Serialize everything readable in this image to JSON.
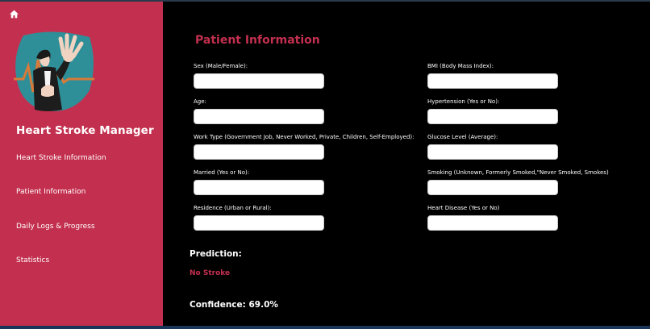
{
  "app": {
    "title": "Heart Stroke Manager"
  },
  "sidebar": {
    "items": [
      {
        "label": "Heart Stroke Information"
      },
      {
        "label": "Patient Information"
      },
      {
        "label": "Daily Logs & Progress"
      },
      {
        "label": "Statistics"
      }
    ]
  },
  "main": {
    "title": "Patient Information",
    "left_fields": [
      {
        "label": "Sex (Male/Female):",
        "value": ""
      },
      {
        "label": "Age:",
        "value": ""
      },
      {
        "label": "Work Type (Government Job, Never Worked, Private, Children, Self-Employed):",
        "value": ""
      },
      {
        "label": "Married (Yes or No):",
        "value": ""
      },
      {
        "label": "Residence (Urban or Rural):",
        "value": ""
      }
    ],
    "right_fields": [
      {
        "label": "BMI (Body Mass Index):",
        "value": ""
      },
      {
        "label": "Hypertension (Yes or No):",
        "value": ""
      },
      {
        "label": "Glucose Level (Average):",
        "value": ""
      },
      {
        "label": "Smoking (Unknown, Formerly Smoked,\"Never Smoked, Smokes)",
        "value": ""
      },
      {
        "label": "Heart Disease (Yes or No)",
        "value": ""
      }
    ],
    "prediction_label": "Prediction:",
    "prediction_value": "No Stroke",
    "confidence": "Confidence: 69.0%"
  },
  "colors": {
    "accent": "#c3304f",
    "background": "#000000",
    "text": "#ffffff"
  },
  "icons": {
    "home": "home-icon",
    "logo": "stressed-person-illustration"
  }
}
